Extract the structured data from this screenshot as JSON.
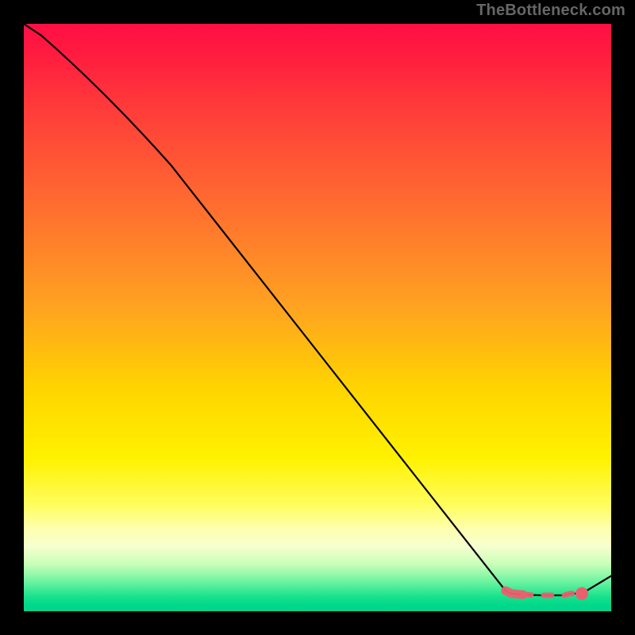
{
  "watermark": "TheBottleneck.com",
  "colors": {
    "background": "#000000",
    "curve": "#000000",
    "highlight": "#e9616f",
    "gradient_top": "#ff0f45",
    "gradient_mid": "#fff200",
    "gradient_green": "#00d68e"
  },
  "chart_data": {
    "type": "line",
    "title": "",
    "xlabel": "",
    "ylabel": "",
    "xlim": [
      0,
      100
    ],
    "ylim": [
      0,
      100
    ],
    "x": [
      0,
      3,
      25,
      82,
      83,
      85,
      88,
      90,
      92,
      93,
      95,
      100
    ],
    "values": [
      100,
      98,
      76,
      3.5,
      3,
      2.8,
      2.7,
      2.7,
      2.7,
      3,
      3,
      6
    ],
    "highlight_segment": {
      "x_start": 82,
      "x_end": 95
    },
    "end_marker_x": 95
  }
}
